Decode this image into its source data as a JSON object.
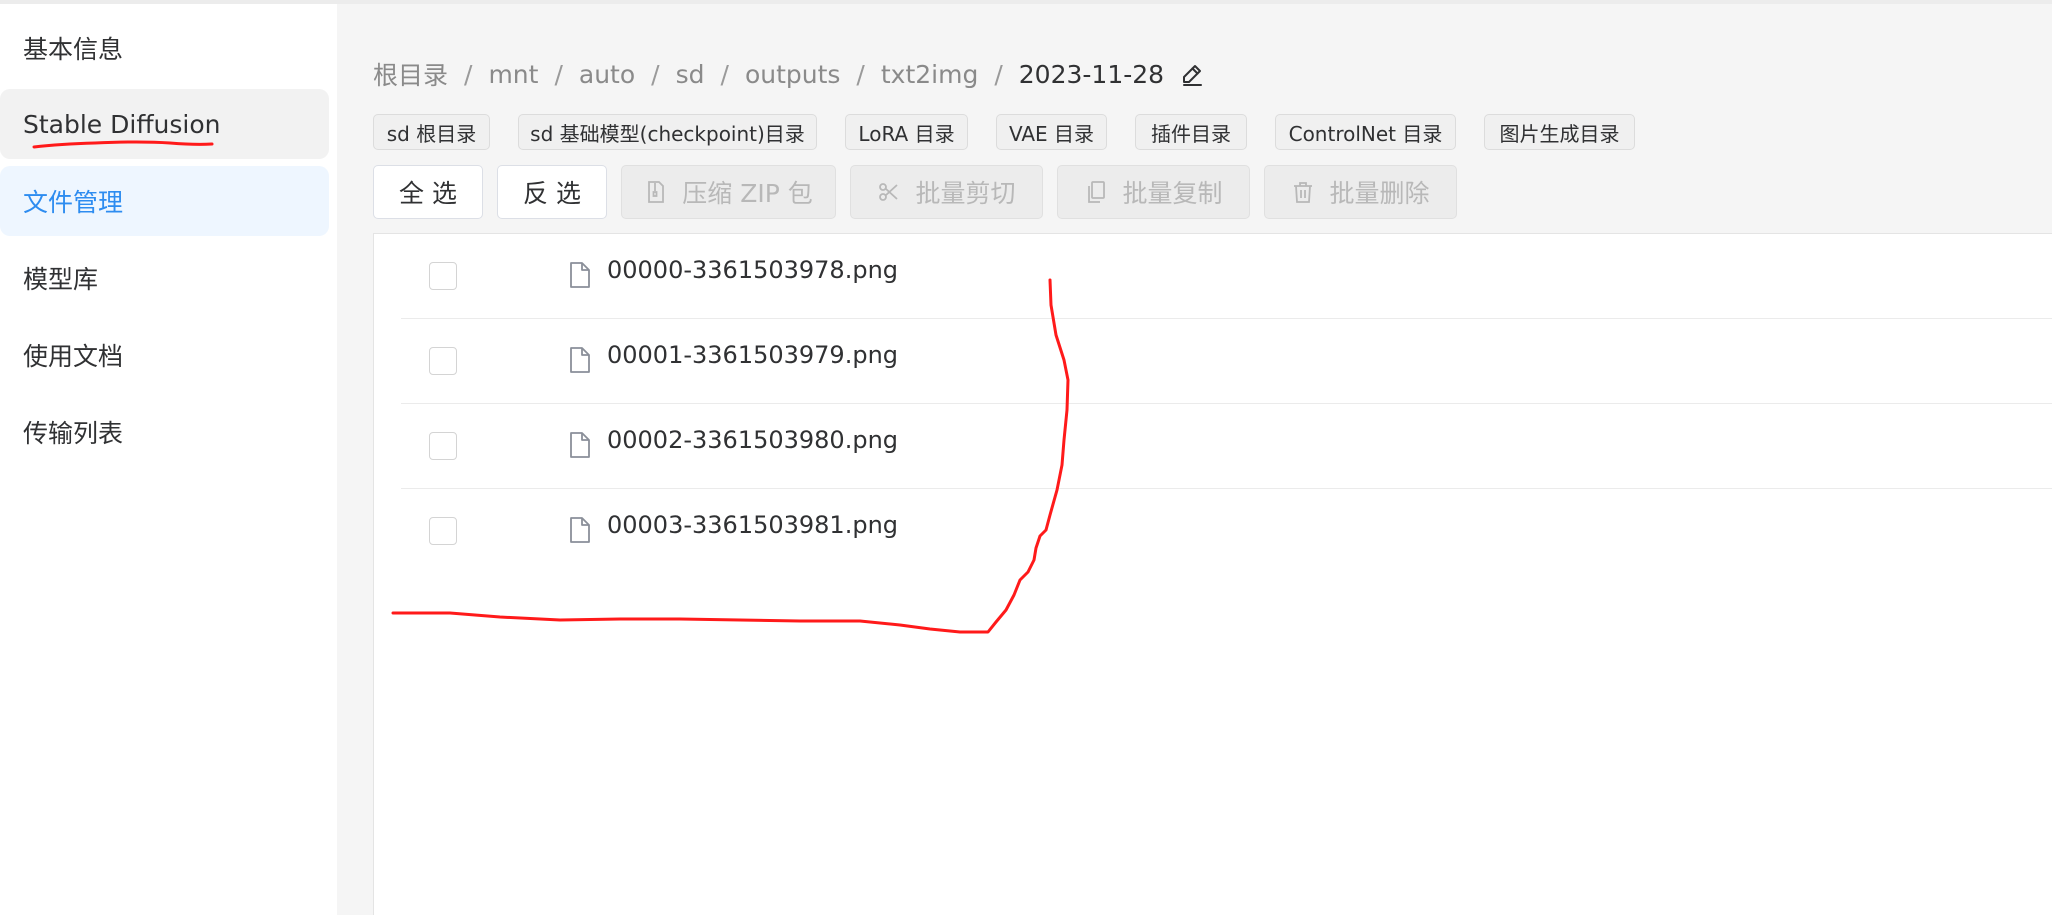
{
  "sidebar": {
    "items": [
      {
        "label": "基本信息"
      },
      {
        "label": "Stable Diffusion"
      },
      {
        "label": "文件管理"
      },
      {
        "label": "模型库"
      },
      {
        "label": "使用文档"
      },
      {
        "label": "传输列表"
      }
    ]
  },
  "breadcrumb": {
    "items": [
      "根目录",
      "mnt",
      "auto",
      "sd",
      "outputs",
      "txt2img",
      "2023-11-28"
    ],
    "separator": "/",
    "edit_icon": "pencil-icon"
  },
  "shortcuts": [
    {
      "label": "sd 根目录"
    },
    {
      "label": "sd 基础模型(checkpoint)目录"
    },
    {
      "label": "LoRA 目录"
    },
    {
      "label": "VAE 目录"
    },
    {
      "label": "插件目录"
    },
    {
      "label": "ControlNet 目录"
    },
    {
      "label": "图片生成目录"
    }
  ],
  "toolbar": {
    "select_all": "全 选",
    "invert_select": "反 选",
    "zip": "压缩 ZIP 包",
    "batch_cut": "批量剪切",
    "batch_copy": "批量复制",
    "batch_delete": "批量删除",
    "icons": {
      "zip": "zip-file-icon",
      "cut": "scissors-icon",
      "copy": "copy-icon",
      "delete": "trash-icon"
    }
  },
  "files": [
    {
      "name": "00000-3361503978.png"
    },
    {
      "name": "00001-3361503979.png"
    },
    {
      "name": "00002-3361503980.png"
    },
    {
      "name": "00003-3361503981.png"
    }
  ],
  "colors": {
    "accent": "#2d8cf0",
    "active_bg": "#eef6ff",
    "annotation": "#ff1a1a"
  }
}
